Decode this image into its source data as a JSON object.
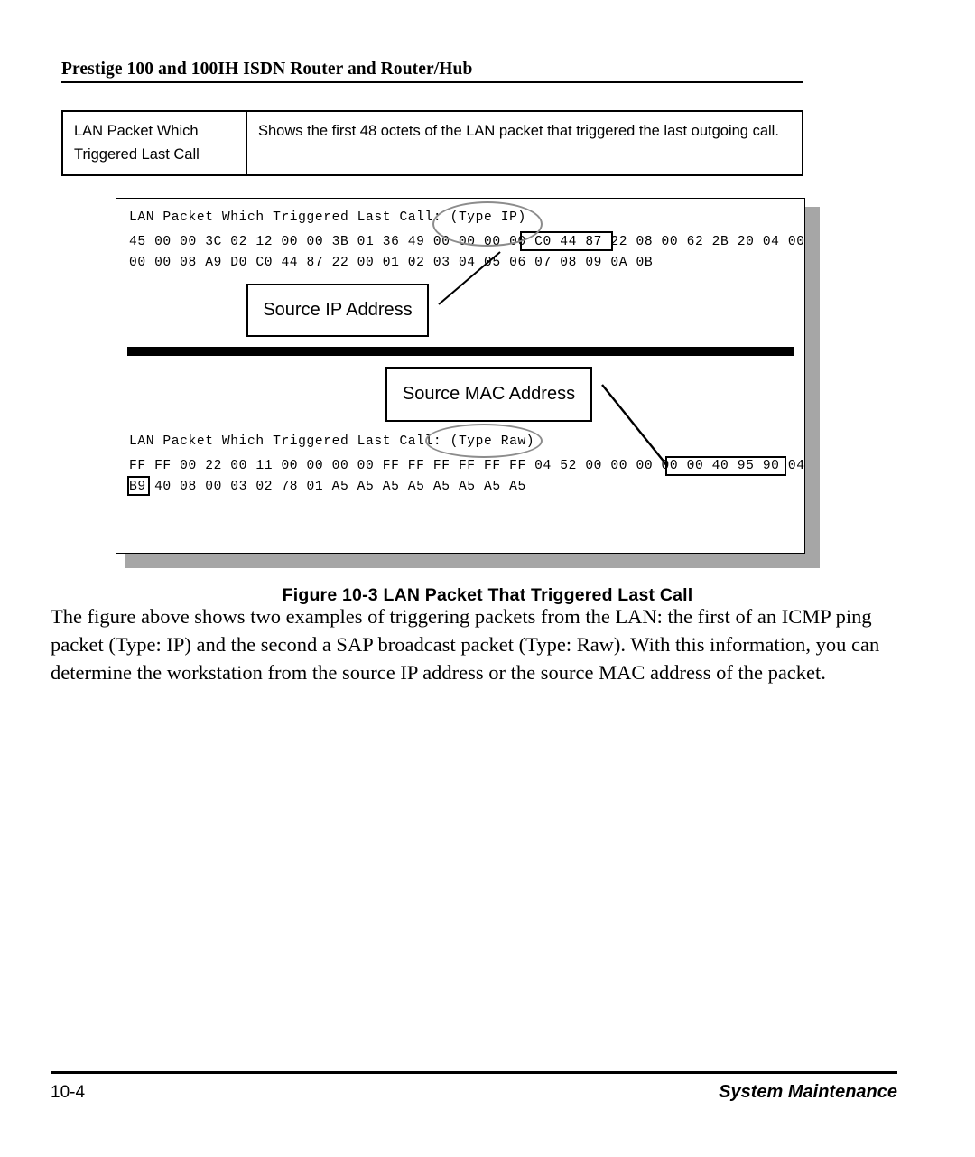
{
  "header": {
    "title": "Prestige 100 and 100IH ISDN Router and Router/Hub"
  },
  "definition_table": {
    "term": "LAN Packet Which Triggered Last Call",
    "description": "Shows the first 48 octets of the LAN packet that triggered the last outgoing call."
  },
  "figure": {
    "caption": "Figure 10-3 LAN Packet That Triggered Last Call",
    "packet_ip": {
      "title": "LAN Packet Which Triggered Last Call: (Type IP)",
      "line1": "45 00 00 3C 02 12 00 00 3B 01 36 49 00 00 00 00 C0 44 87 22 08 00 62 2B 20 04 00",
      "line2": "00 00 08 A9 D0 C0 44 87 22 00 01 02 03 04 05 06 07 08 09 0A 0B",
      "highlight": "C0 44 87 22",
      "annotation_circle": "(Type IP)"
    },
    "packet_raw": {
      "title": "LAN Packet Which Triggered Last Call: (Type Raw)",
      "line1": "FF FF 00 22 00 11 00 00 00 00 FF FF FF FF FF FF 04 52 00 00 00 00 00 40 95 90 04",
      "line2": "B9 40 08 00 03 02 78 01 A5 A5 A5 A5 A5 A5 A5 A5",
      "highlight": "00 40 95 90 04 B9",
      "annotation_circle": "(Type Raw)"
    },
    "callouts": {
      "source_ip": "Source IP Address",
      "source_mac": "Source MAC Address"
    }
  },
  "body": {
    "paragraph": "The figure above shows two examples of triggering packets from the LAN: the first of an ICMP ping packet (Type: IP) and the second a SAP broadcast packet (Type: Raw). With this information, you can determine the workstation from the source IP address or the source MAC address of the packet."
  },
  "footer": {
    "page_number": "10-4",
    "section": "System Maintenance"
  },
  "colors": {
    "ink": "#000000",
    "shadow": "#a6a6a6",
    "annotation": "#8c8c8c",
    "page": "#ffffff"
  }
}
